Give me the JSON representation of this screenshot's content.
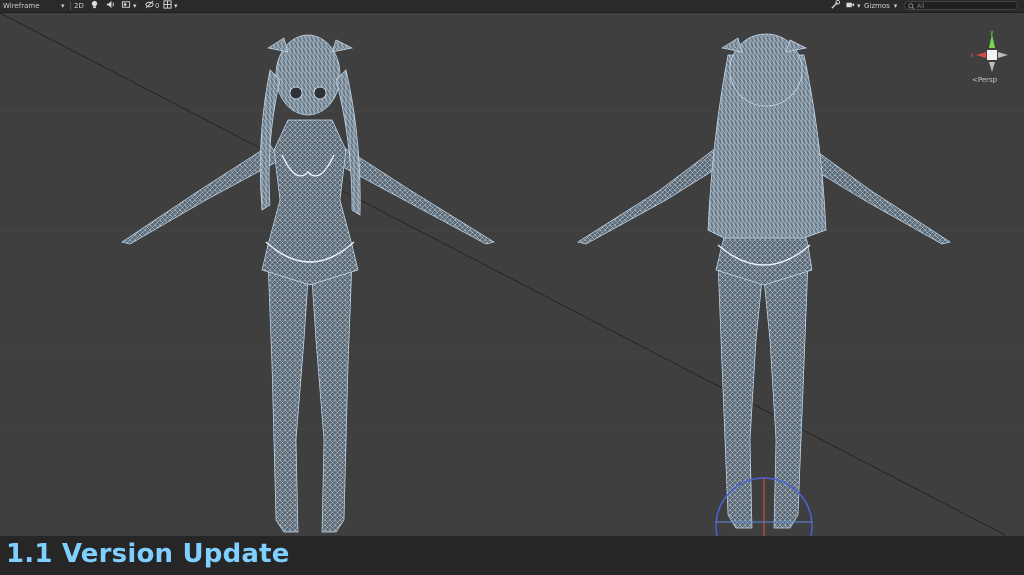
{
  "toolbar": {
    "shading_mode": "Wireframe",
    "mode_2d": "2D",
    "hidden_count": "0",
    "gizmos_label": "Gizmos",
    "search_placeholder": "All"
  },
  "viewport": {
    "projection_label": "Persp",
    "axis_x": "x",
    "axis_y": "y"
  },
  "banner": {
    "text": "1.1 Version Update"
  },
  "colors": {
    "accent_text": "#7fd0ff",
    "wireframe": "#b8d4ec",
    "viewport_bg": "#3f3f3f"
  }
}
